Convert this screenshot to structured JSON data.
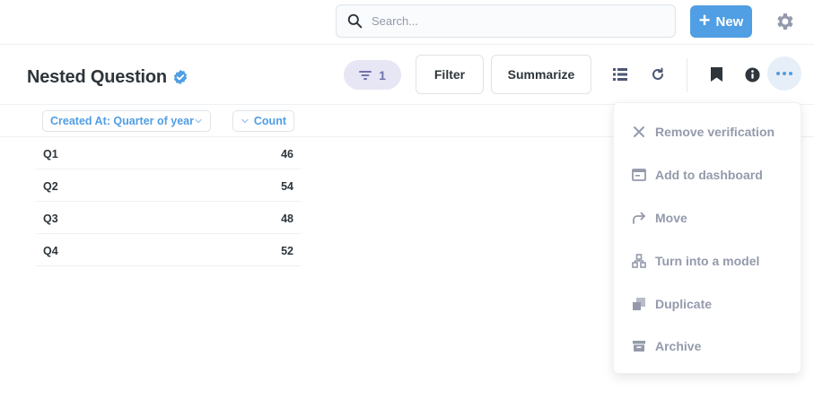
{
  "navbar": {
    "search": {
      "placeholder": "Search..."
    },
    "new_button_label": "New",
    "settings_icon": "gear-icon"
  },
  "question": {
    "title": "Nested Question",
    "verified_icon": "verified-badge-icon",
    "filter_count": "1",
    "filter_button_label": "Filter",
    "summarize_button_label": "Summarize"
  },
  "table": {
    "columns": [
      {
        "label": "Created At: Quarter of year"
      },
      {
        "label": "Count"
      }
    ],
    "rows": [
      {
        "quarter": "Q1",
        "count": "46"
      },
      {
        "quarter": "Q2",
        "count": "54"
      },
      {
        "quarter": "Q3",
        "count": "48"
      },
      {
        "quarter": "Q4",
        "count": "52"
      }
    ]
  },
  "menu": {
    "items": [
      {
        "label": "Remove verification",
        "icon": "close-icon"
      },
      {
        "label": "Add to dashboard",
        "icon": "dashboard-icon"
      },
      {
        "label": "Move",
        "icon": "move-arrow-icon"
      },
      {
        "label": "Turn into a model",
        "icon": "model-icon"
      },
      {
        "label": "Duplicate",
        "icon": "duplicate-icon"
      },
      {
        "label": "Archive",
        "icon": "archive-icon"
      }
    ]
  },
  "colors": {
    "brand": "#509ee3",
    "filter_pill": "#7172ad",
    "muted": "#949aab",
    "text_dark": "#2e353b"
  }
}
